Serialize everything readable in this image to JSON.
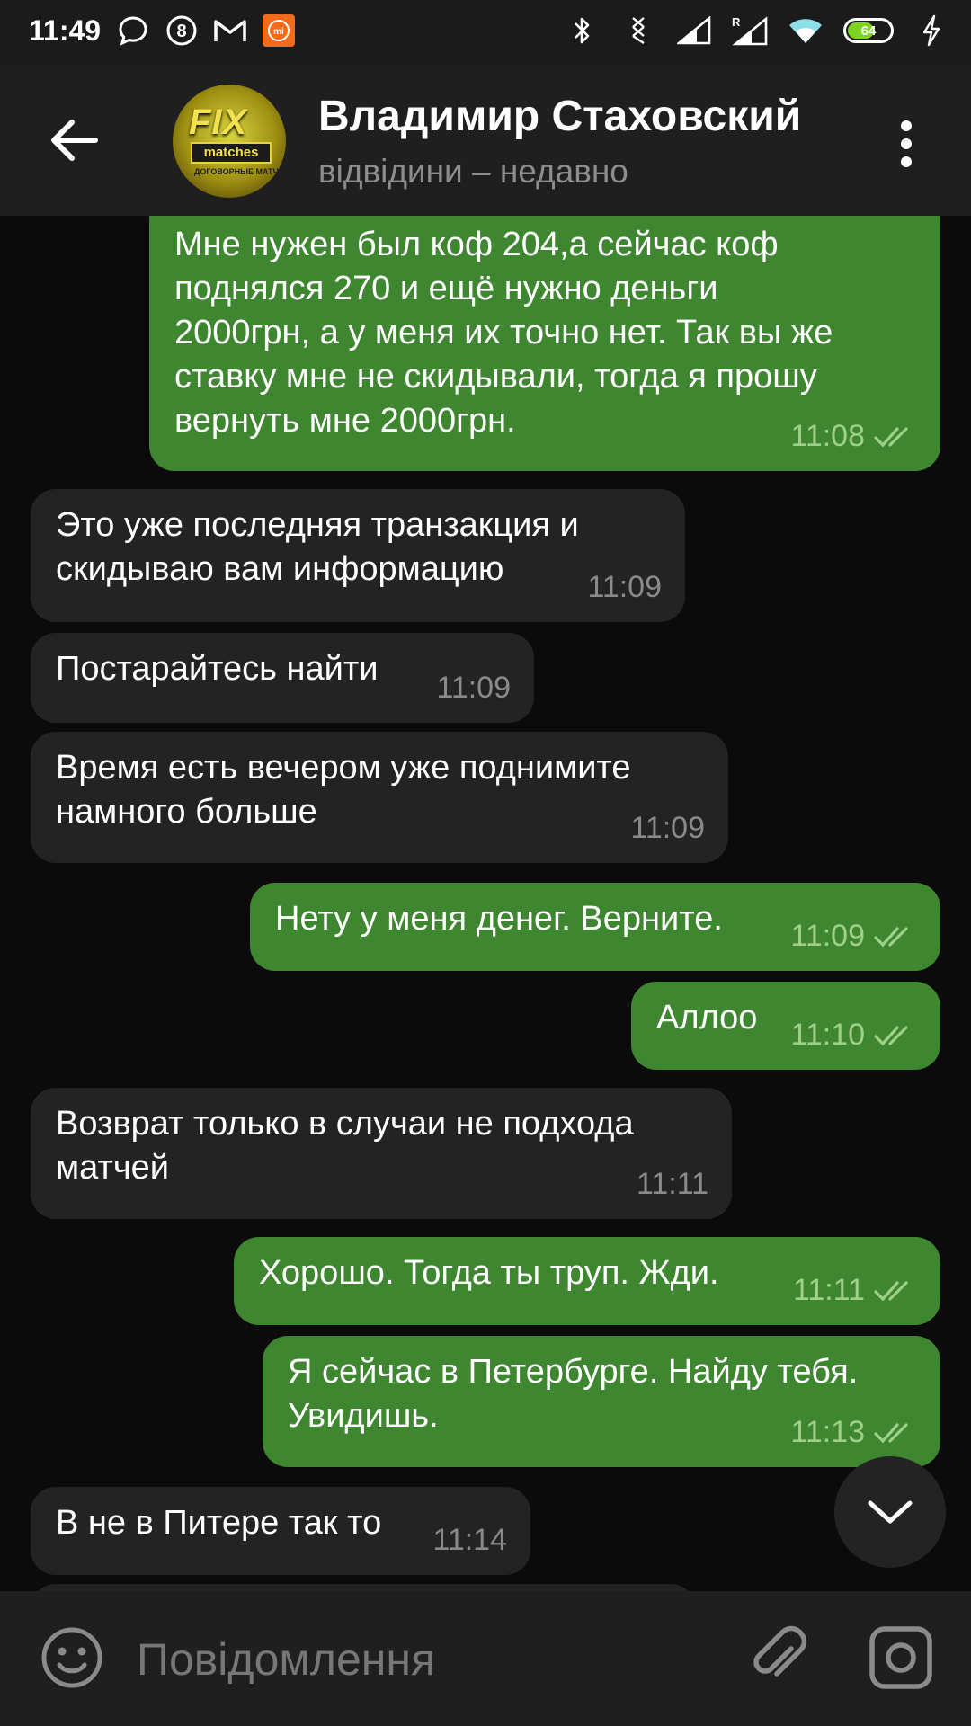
{
  "status_bar": {
    "time": "11:49",
    "battery_level": "64",
    "battery_fraction": 0.64,
    "accent": "#7ed321",
    "left_icons": [
      "chat-bubble-icon",
      "8ball-icon",
      "gmail-icon",
      "mi-icon"
    ],
    "right_icons": [
      "bluetooth-icon",
      "vibrate-icon",
      "signal-icon",
      "signal-roaming-icon",
      "wifi-icon",
      "battery-icon",
      "charging-icon"
    ],
    "mi_label": "mi"
  },
  "header": {
    "title": "Владимир Стаховский",
    "status": "відвідини – недавно",
    "avatar": {
      "text_fix": "FIX",
      "text_matches": "matches",
      "text_sub": "ДОГОВОРНЫЕ МАТЧИ"
    }
  },
  "messages": [
    {
      "direction": "out",
      "text": "Мне нужен был коф 204,а сейчас коф\nподнялся 270 и ещё нужно деньги\n2000грн, а у меня их точно нет. Так вы же\nставку мне не скидывали, тогда я прошу\nвернуть мне 2000грн.",
      "time": "11:08",
      "read": true
    },
    {
      "direction": "in",
      "text": "Это уже последняя транзакция и\nскидываю вам информацию",
      "time": "11:09"
    },
    {
      "direction": "in",
      "text": "Постарайтесь найти",
      "time": "11:09"
    },
    {
      "direction": "in",
      "text": "Время есть вечером уже поднимите\nнамного больше",
      "time": "11:09"
    },
    {
      "direction": "out",
      "text": "Нету у меня денег. Верните.",
      "time": "11:09",
      "read": true
    },
    {
      "direction": "out",
      "text": "Аллоо",
      "time": "11:10",
      "read": true
    },
    {
      "direction": "in",
      "text": "Возврат только в случаи не подхода\nматчей",
      "time": "11:11"
    },
    {
      "direction": "out",
      "text": "Хорошо. Тогда ты труп. Жди.",
      "time": "11:11",
      "read": true
    },
    {
      "direction": "out",
      "text": "Я сейчас в Петербурге. Найду тебя.\nУвидишь.",
      "time": "11:13",
      "read": true
    },
    {
      "direction": "in",
      "text": "В не в Питере так то",
      "time": "11:14"
    }
  ],
  "composer": {
    "placeholder": "Повідомлення"
  },
  "colors": {
    "outgoing_bubble": "#3f8630",
    "incoming_bubble": "#232323",
    "background": "#0b0b0b",
    "header": "#1f1f1f"
  }
}
